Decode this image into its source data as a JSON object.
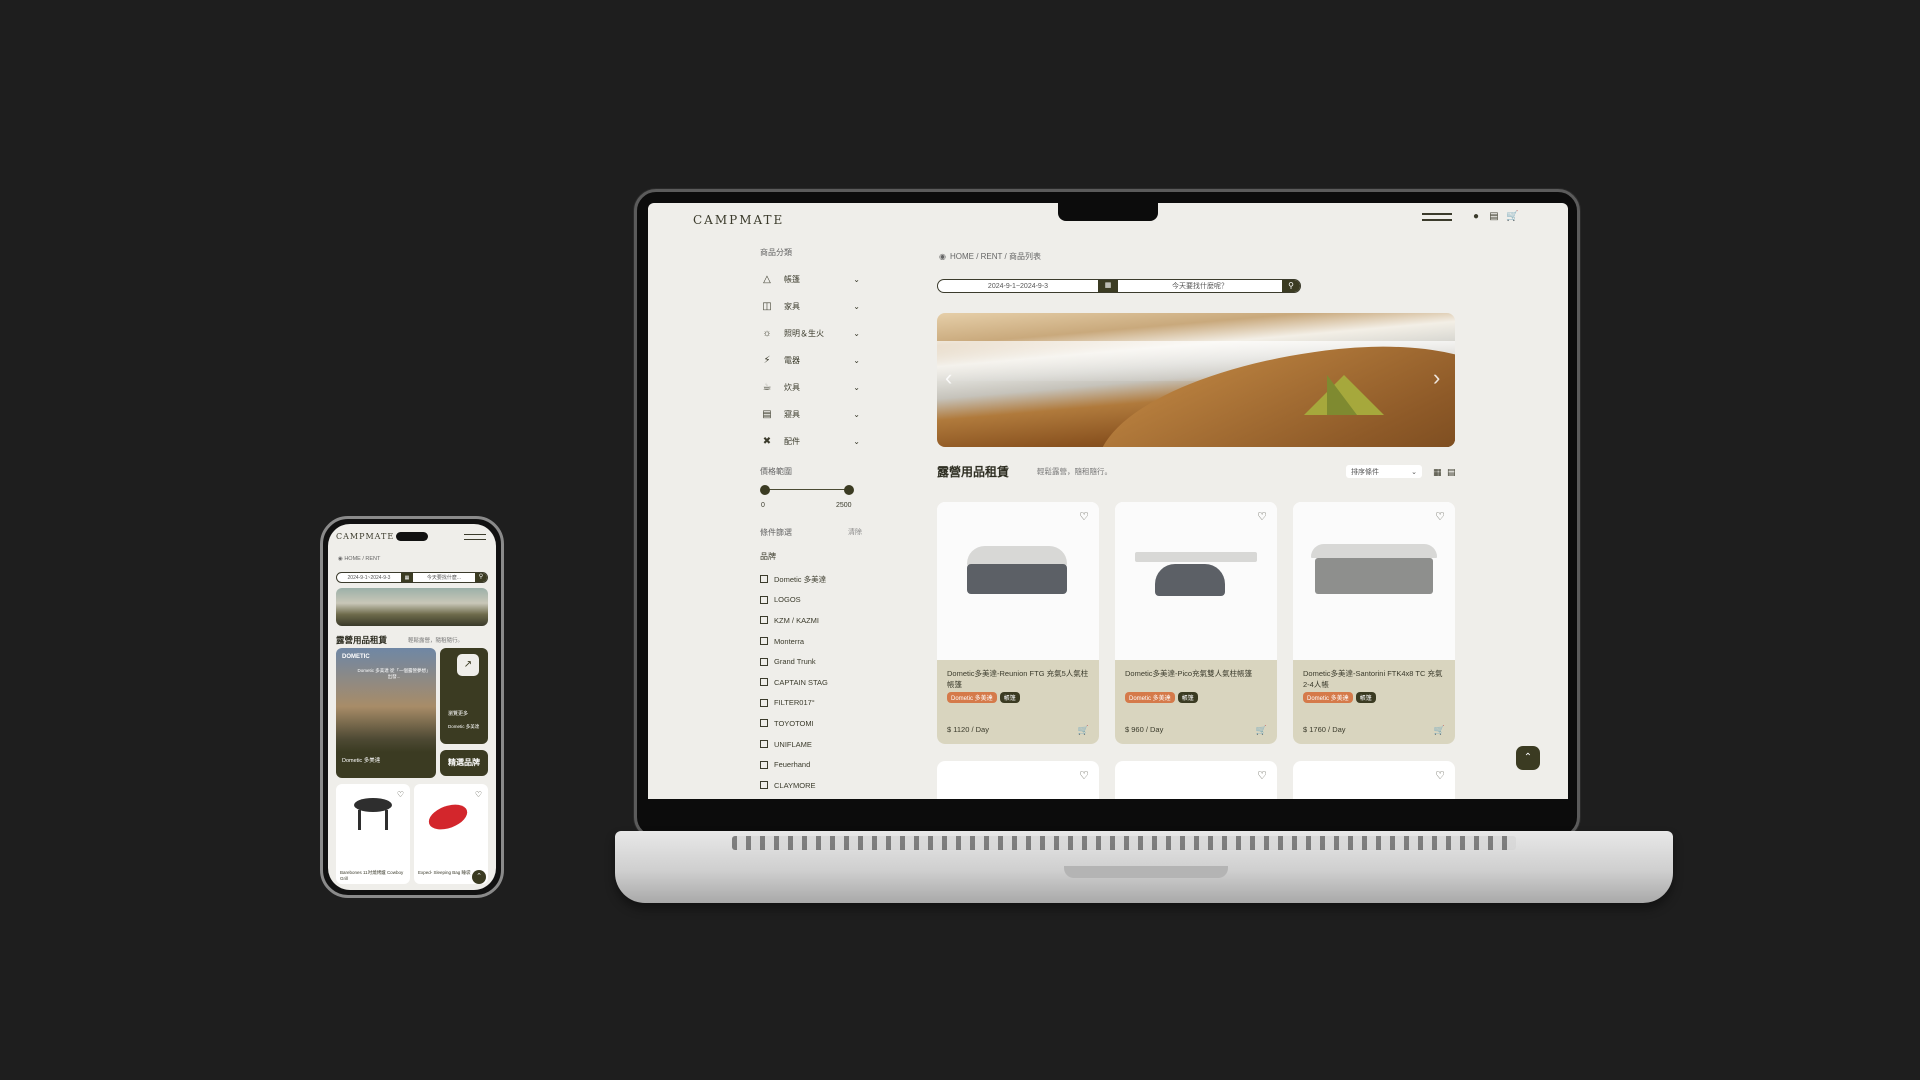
{
  "laptop": {
    "logo": "CAMPMATE",
    "header_icons": [
      "menu-icon",
      "user-icon",
      "message-icon",
      "cart-icon"
    ],
    "sidebar": {
      "category_title": "商品分類",
      "categories": [
        {
          "label": "帳篷",
          "icon": "tent-icon"
        },
        {
          "label": "家具",
          "icon": "chair-icon"
        },
        {
          "label": "照明＆生火",
          "icon": "fire-icon"
        },
        {
          "label": "電器",
          "icon": "plug-icon"
        },
        {
          "label": "炊具",
          "icon": "cookware-icon"
        },
        {
          "label": "寢具",
          "icon": "bed-icon"
        },
        {
          "label": "配件",
          "icon": "tools-icon"
        }
      ],
      "price_title": "價格範圍",
      "price_min": "0",
      "price_max": "2500",
      "condition_title": "條件篩選",
      "clear_label": "清除",
      "brand_title": "品牌",
      "brands": [
        "Dometic 多美達",
        "LOGOS",
        "KZM / KAZMI",
        "Monterra",
        "Grand Trunk",
        "CAPTAIN STAG",
        "FILTER017°",
        "TOYOTOMI",
        "UNIFLAME",
        "Feuerhand",
        "CLAYMORE"
      ]
    },
    "breadcrumb": "HOME / RENT / 商品列表",
    "search": {
      "date_range": "2024-9-1~2024-9-3",
      "placeholder": "今天要找什麼呢？"
    },
    "section_title": "露營用品租賃",
    "section_subtitle": "輕鬆露營，隨租隨行。",
    "sort_label": "排序條件",
    "products": [
      {
        "name": "Dometic多美達-Reunion FTG 充氣5人氣柱帳篷",
        "tags": [
          "Dometic 多美達",
          "帳篷"
        ],
        "price": "$ 1120 / Day"
      },
      {
        "name": "Dometic多美達-Pico充氣雙人氣柱帳篷",
        "tags": [
          "Dometic 多美達",
          "帳篷"
        ],
        "price": "$ 960 / Day"
      },
      {
        "name": "Dometic多美達-Santorini FTK4x8 TC 充氣2-4人帳",
        "tags": [
          "Dometic 多美達",
          "帳篷"
        ],
        "price": "$ 1760 / Day"
      }
    ],
    "colors": {
      "accent": "#3b3b22",
      "tag_orange": "#d57a4a",
      "card_info": "#d9d5bf",
      "background": "#efeeea"
    }
  },
  "phone": {
    "logo": "CAMPMATE",
    "breadcrumb": "HOME / RENT",
    "search": {
      "date_range": "2024-9-1~2024-9-3",
      "placeholder": "今天要找什麼..."
    },
    "section_title": "露營用品租賃",
    "section_subtitle": "輕鬆露營，隨租隨行。",
    "promo": {
      "brand": "DOMETIC",
      "text": "Dometic 多美達 從「一個露營夢想」出發...",
      "footer": "Dometic 多美達"
    },
    "more": {
      "label": "瀏覽更多",
      "brand": "Dometic 多美達"
    },
    "pick_label": "精選品牌",
    "products": [
      {
        "name": "Barebones 11吋燒烤爐 Cowboy Grill"
      },
      {
        "name": "Exped- Sleeping Bag 睡袋"
      }
    ]
  }
}
